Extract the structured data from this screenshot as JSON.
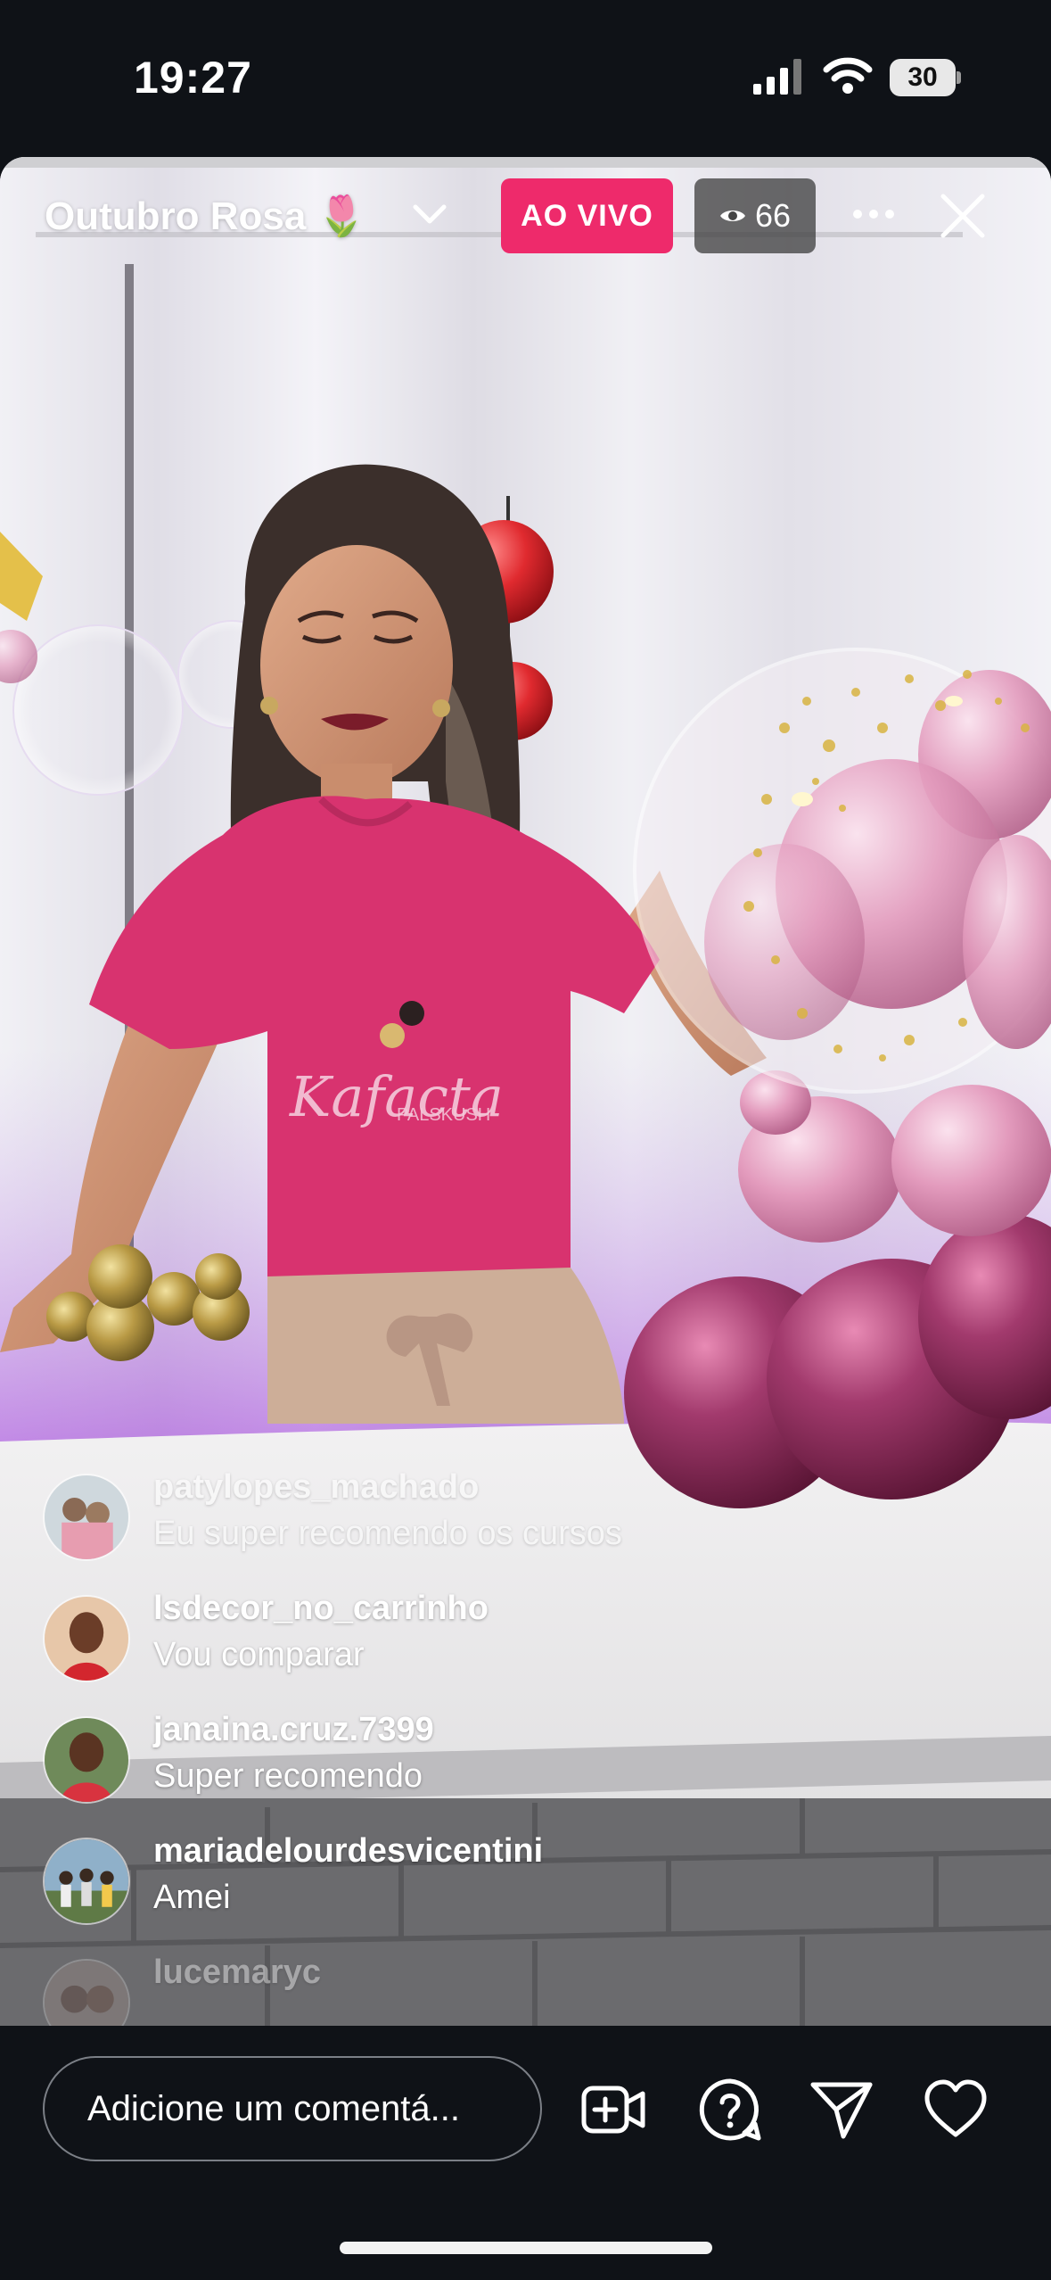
{
  "status_bar": {
    "time": "19:27",
    "battery": "30",
    "icons": [
      "signal-icon",
      "wifi-icon",
      "battery-icon"
    ]
  },
  "live": {
    "title": "Outubro Rosa 🌷",
    "live_label": "AO VIVO",
    "viewer_count": "66",
    "icons": [
      "chevron-down-icon",
      "eye-icon",
      "more-icon",
      "close-icon"
    ]
  },
  "comments": [
    {
      "user": "patylopes_machado",
      "text": "Eu super recomendo os cursos"
    },
    {
      "user": "lsdecor_no_carrinho",
      "text": "Vou comparar"
    },
    {
      "user": "janaina.cruz.7399",
      "text": "Super recomendo"
    },
    {
      "user": "mariadelourdesvicentini",
      "text": "Amei"
    },
    {
      "user": "lucemaryc",
      "text": ""
    }
  ],
  "composer": {
    "placeholder": "Adicione um comentá...",
    "icons": [
      "add-guest-icon",
      "question-icon",
      "share-icon",
      "heart-icon"
    ]
  },
  "colors": {
    "live_badge": "#ee2a6b",
    "background": "#0f1217",
    "shirt": "#d8336f"
  }
}
